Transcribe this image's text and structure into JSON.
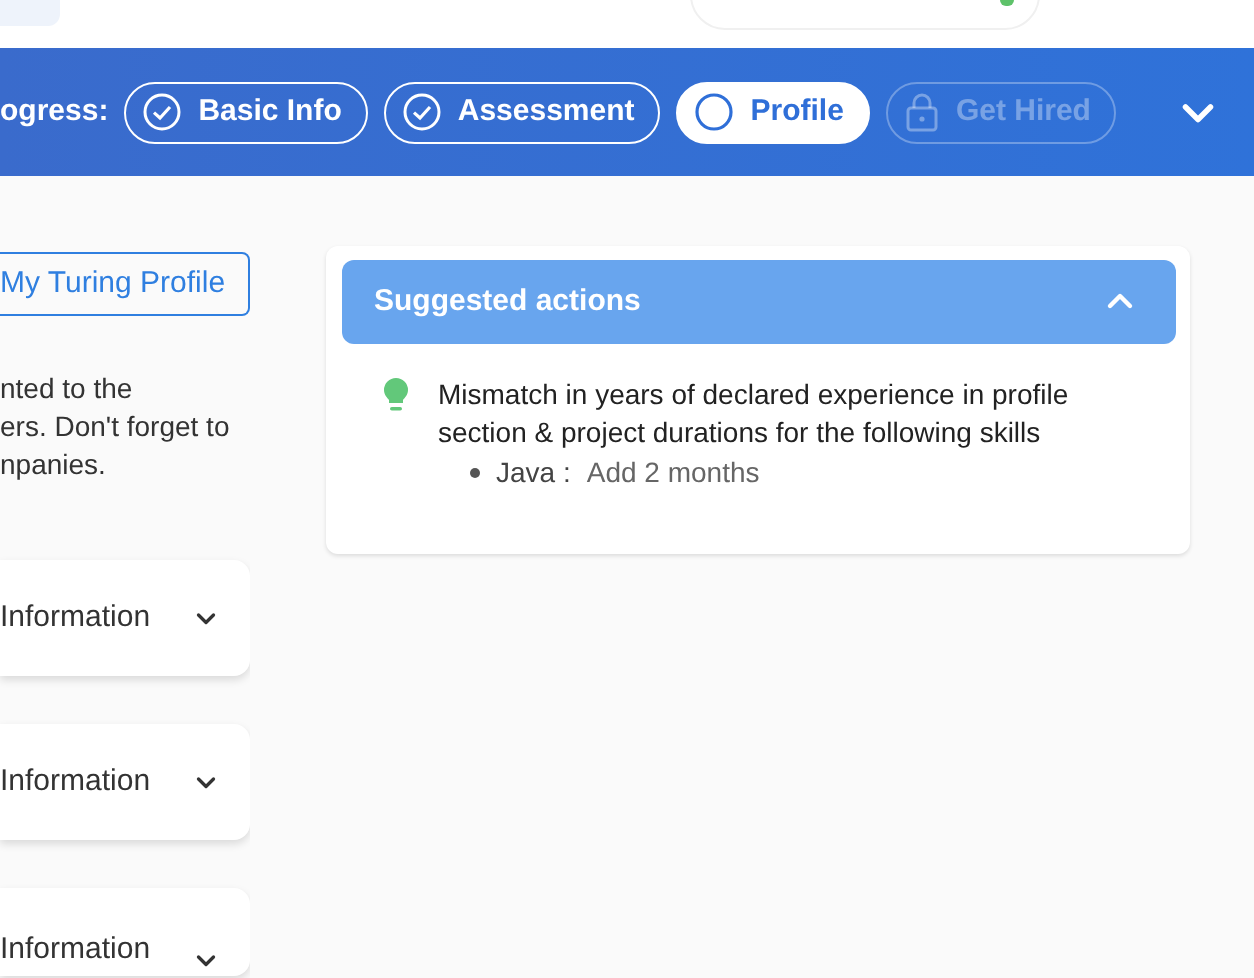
{
  "progress": {
    "label": "ogress:",
    "steps": [
      {
        "label": "Basic Info",
        "kind": "done"
      },
      {
        "label": "Assessment",
        "kind": "done"
      },
      {
        "label": "Profile",
        "kind": "current"
      },
      {
        "label": "Get Hired",
        "kind": "locked"
      }
    ]
  },
  "left": {
    "profile_button": "My Turing Profile",
    "note_lines": [
      "nted to the",
      "ers. Don't forget to",
      "npanies."
    ],
    "sections": [
      {
        "title": "Information",
        "expanded": false
      },
      {
        "title": "Information",
        "expanded": false
      },
      {
        "title": "Information",
        "expanded": false
      }
    ]
  },
  "suggested_actions": {
    "title": "Suggested actions",
    "expanded": true,
    "items": [
      {
        "text": "Mismatch in years of declared experience in profile section & project durations for the following skills",
        "details": [
          {
            "skill": "Java :",
            "value": "Add 2 months"
          }
        ]
      }
    ]
  }
}
